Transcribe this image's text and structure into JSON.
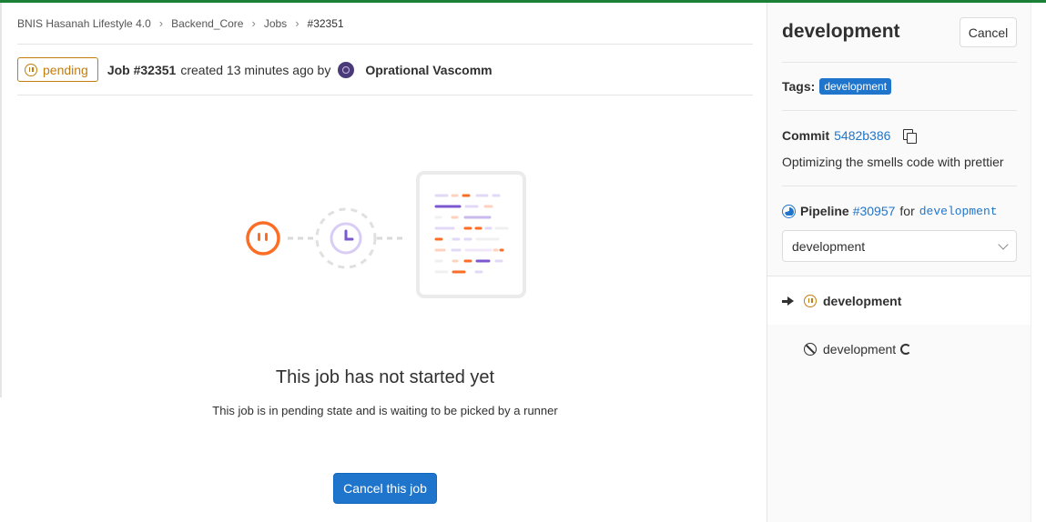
{
  "breadcrumb": [
    "BNIS Hasanah Lifestyle 4.0",
    "Backend_Core",
    "Jobs",
    "#32351"
  ],
  "job": {
    "status": "pending",
    "title": "Job #32351",
    "meta": "created 13 minutes ago by",
    "author": "Oprational Vascomm"
  },
  "empty_state": {
    "title": "This job has not started yet",
    "subtitle": "This job is in pending state and is waiting to be picked by a runner",
    "cancel_label": "Cancel this job"
  },
  "sidebar": {
    "title": "development",
    "cancel_label": "Cancel",
    "tags_label": "Tags:",
    "tag": "development",
    "commit_label": "Commit",
    "commit_sha": "5482b386",
    "commit_message": "Optimizing the smells code with prettier",
    "pipeline_label": "Pipeline",
    "pipeline_id": "#30957",
    "for_label": "for",
    "pipeline_ref": "development",
    "stage_select": "development",
    "jobs": [
      {
        "name": "development",
        "status": "pending",
        "current": true
      },
      {
        "name": "development",
        "status": "skipped",
        "current": false
      }
    ]
  },
  "colors": {
    "accent": "#1f75cb",
    "pending": "#c17d10",
    "illustration_orange": "#fc6d26",
    "illustration_purple": "#7b58cf"
  }
}
